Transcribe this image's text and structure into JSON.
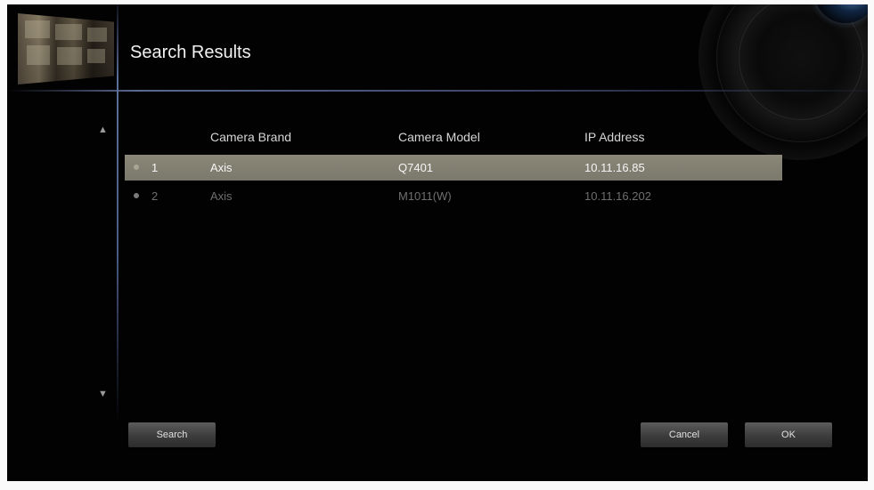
{
  "header": {
    "title": "Search Results"
  },
  "table": {
    "columns": [
      "Camera Brand",
      "Camera Model",
      "IP Address"
    ],
    "rows": [
      {
        "index": "1",
        "brand": "Axis",
        "model": "Q7401",
        "ip": "10.11.16.85",
        "selected": true
      },
      {
        "index": "2",
        "brand": "Axis",
        "model": "M1011(W)",
        "ip": "10.11.16.202",
        "selected": false
      }
    ]
  },
  "icons": {
    "scroll_up": "triangle-up-icon",
    "scroll_down": "triangle-down-icon",
    "thumbnail": "camera-grid-thumbnail",
    "decoration": "camera-lens"
  },
  "buttons": {
    "search": "Search",
    "cancel": "Cancel",
    "ok": "OK"
  },
  "colors": {
    "selected_row": "#7b796c",
    "accent_line": "#5a6a90",
    "background": "#020202"
  }
}
